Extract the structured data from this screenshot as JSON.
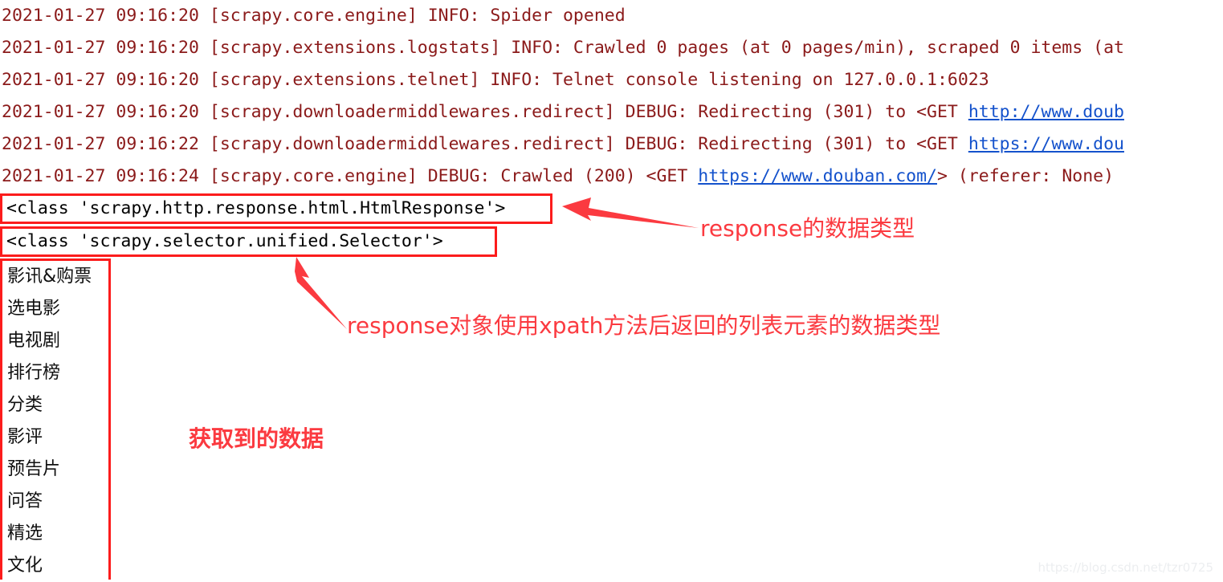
{
  "console": {
    "lines": [
      {
        "id": "log-line-1",
        "pre": "2021-01-27 09:16:20 [scrapy.core.engine] INFO: Spider opened",
        "url": "",
        "post": ""
      },
      {
        "id": "log-line-2",
        "pre": "2021-01-27 09:16:20 [scrapy.extensions.logstats] INFO: Crawled 0 pages (at 0 pages/min), scraped 0 items (at",
        "url": "",
        "post": ""
      },
      {
        "id": "log-line-3",
        "pre": "2021-01-27 09:16:20 [scrapy.extensions.telnet] INFO: Telnet console listening on 127.0.0.1:6023",
        "url": "",
        "post": ""
      },
      {
        "id": "log-line-4",
        "pre": "2021-01-27 09:16:20 [scrapy.downloadermiddlewares.redirect] DEBUG: Redirecting (301) to <GET ",
        "url": "http://www.doub",
        "post": ""
      },
      {
        "id": "log-line-5",
        "pre": "2021-01-27 09:16:22 [scrapy.downloadermiddlewares.redirect] DEBUG: Redirecting (301) to <GET ",
        "url": "https://www.dou",
        "post": ""
      },
      {
        "id": "log-line-6",
        "pre": "2021-01-27 09:16:24 [scrapy.core.engine] DEBUG: Crawled (200) <GET ",
        "url": "https://www.douban.com/",
        "post": "> (referer: None)"
      }
    ]
  },
  "output": {
    "response_class": "<class 'scrapy.http.response.html.HtmlResponse'>",
    "selector_class": "<class 'scrapy.selector.unified.Selector'>"
  },
  "scraped_list": {
    "items": [
      "影讯&购票",
      "选电影",
      "电视剧",
      "排行榜",
      "分类",
      "影评",
      "预告片",
      "问答",
      "精选",
      "文化"
    ]
  },
  "annotations": {
    "response_type": "response的数据类型",
    "selector_type": "response对象使用xpath方法后返回的列表元素的数据类型",
    "scraped_data": "获取到的数据"
  },
  "watermark": {
    "text": "https://blog.csdn.net/tzr0725"
  },
  "colors": {
    "log_text": "#8b1a1a",
    "url_link": "#1452cc",
    "annotation_red": "#fb3a40",
    "box_border": "#fc1c1c",
    "output_text": "#000000",
    "watermark": "#eceef0"
  }
}
